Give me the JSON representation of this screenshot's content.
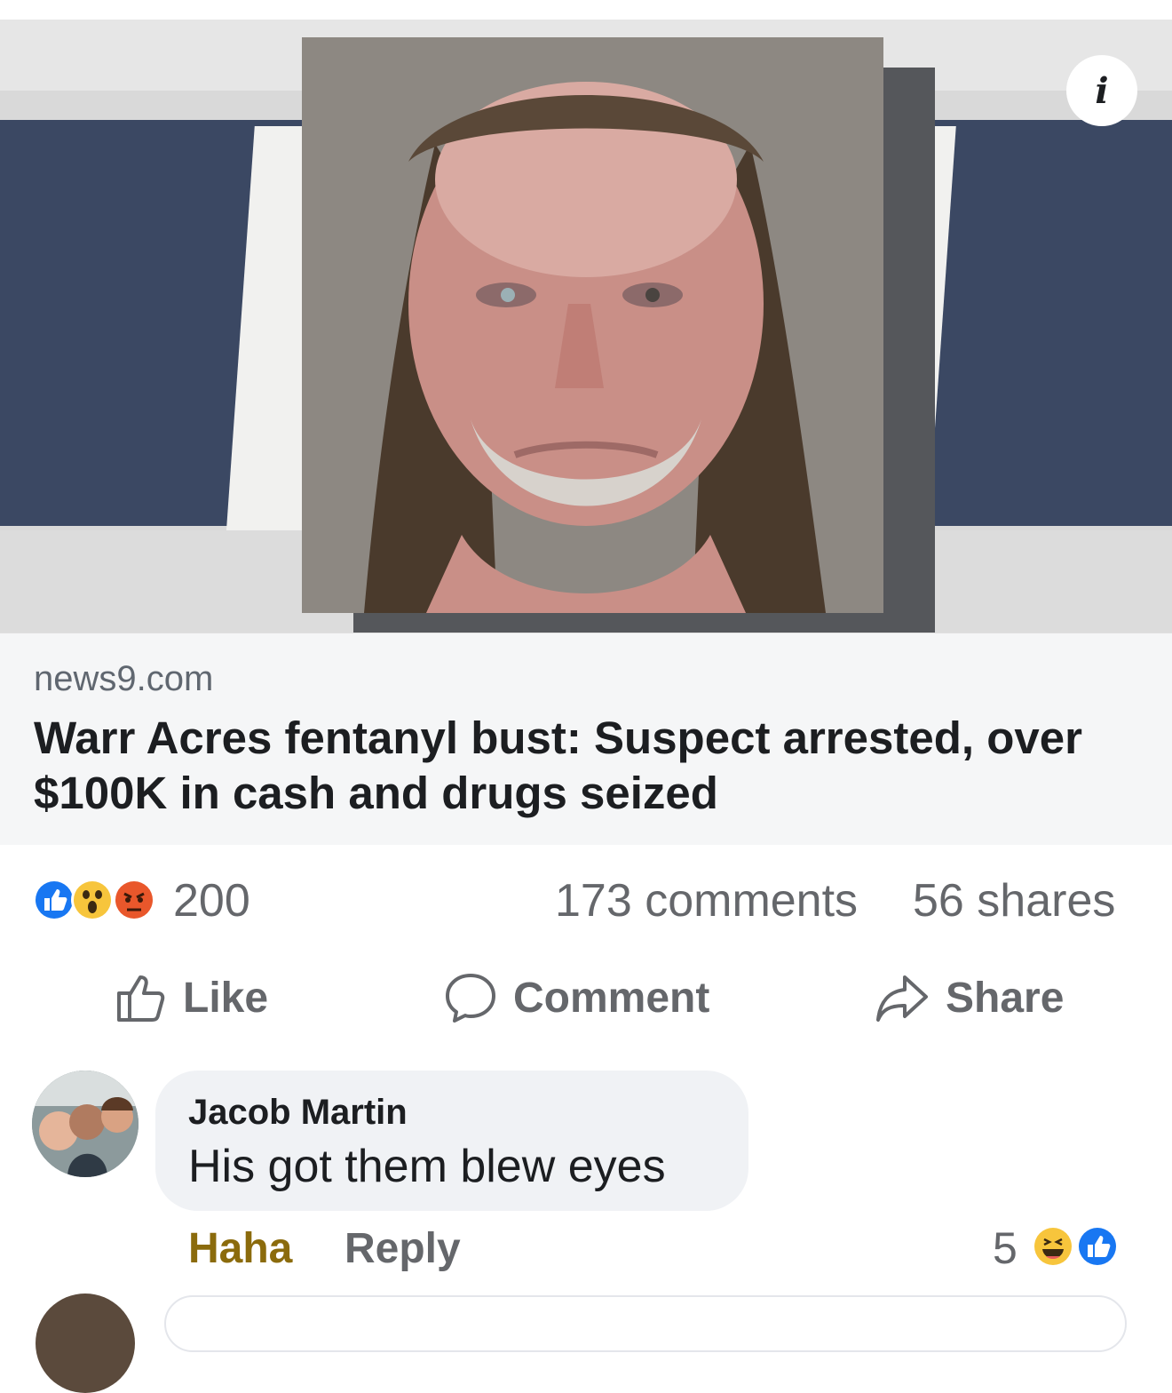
{
  "post": {
    "link_domain": "news9.com",
    "headline": "Warr Acres fentanyl bust: Suspect arrested, over $100K in cash and drugs seized"
  },
  "stats": {
    "reaction_count": "200",
    "comments": "173 comments",
    "shares": "56 shares",
    "reaction_icons": [
      "like-icon",
      "wow-icon",
      "angry-icon"
    ]
  },
  "actions": {
    "like": "Like",
    "comment": "Comment",
    "share": "Share"
  },
  "comment": {
    "author": "Jacob Martin",
    "text": "His got them blew eyes",
    "haha_label": "Haha",
    "reply_label": "Reply",
    "reaction_count": "5",
    "reaction_icons": [
      "haha-icon",
      "like-icon"
    ]
  },
  "colors": {
    "fb_blue": "#1877f2",
    "haha_gold": "#8b6b0c",
    "muted_text": "#65676b"
  }
}
